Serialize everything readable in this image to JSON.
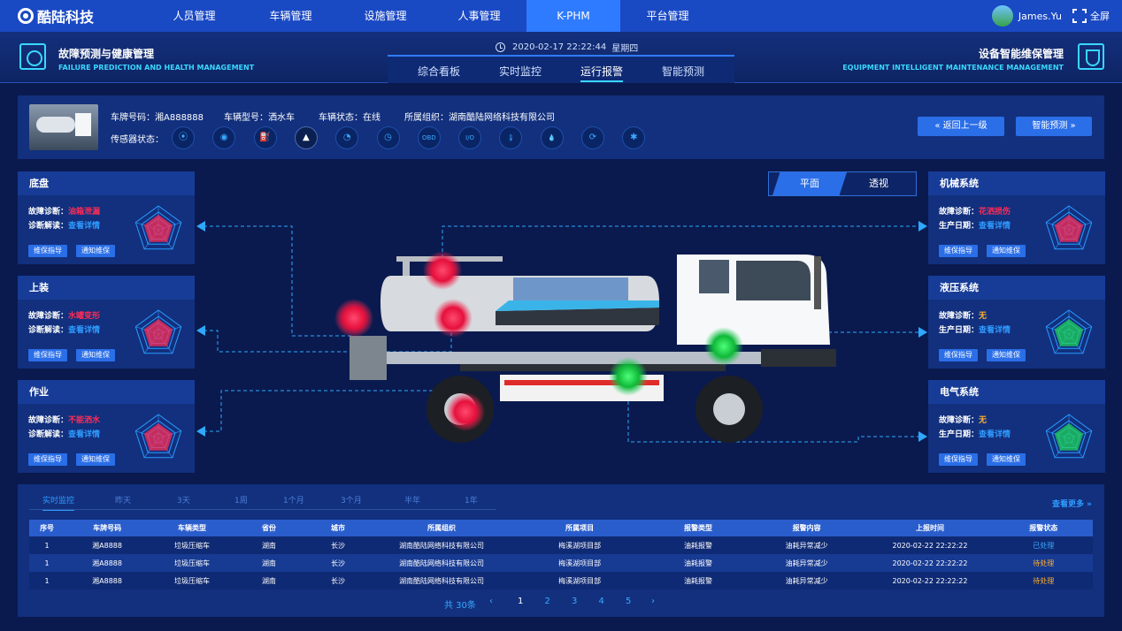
{
  "brand": {
    "name": "酷陆科技"
  },
  "nav": {
    "items": [
      {
        "label": "人员管理"
      },
      {
        "label": "车辆管理"
      },
      {
        "label": "设施管理"
      },
      {
        "label": "人事管理"
      },
      {
        "label": "K-PHM"
      },
      {
        "label": "平台管理"
      }
    ],
    "active_index": 4,
    "user_name": "James.Yu",
    "fullscreen_label": "全屏"
  },
  "subheader": {
    "left_title_cn": "故障预测与健康管理",
    "left_title_en": "FAILURE PREDICTION AND HEALTH MANAGEMENT",
    "right_title_cn": "设备智能维保管理",
    "right_title_en": "EQUIPMENT INTELLIGENT MAINTENANCE MANAGEMENT",
    "datetime": "2020-02-17 22:22:44",
    "weekday": "星期四",
    "tabs": [
      {
        "label": "综合看板"
      },
      {
        "label": "实时监控"
      },
      {
        "label": "运行报警"
      },
      {
        "label": "智能预测"
      }
    ],
    "active_tab": 2
  },
  "vehicle": {
    "plate_label": "车牌号码：",
    "plate": "湘A888888",
    "model_label": "车辆型号：",
    "model": "洒水车",
    "status_label": "车辆状态：",
    "status": "在线",
    "org_label": "所属组织：",
    "org": "湖南酷陆网络科技有限公司",
    "sensor_label": "传感器状态："
  },
  "sensors": [
    {
      "icon": "location-icon",
      "glyph": "⦿"
    },
    {
      "icon": "camera-icon",
      "glyph": "◉"
    },
    {
      "icon": "fuel-icon",
      "glyph": "⛽"
    },
    {
      "icon": "alarm-icon",
      "glyph": "▲"
    },
    {
      "icon": "gauge-icon",
      "glyph": "◔"
    },
    {
      "icon": "timer-icon",
      "glyph": "◷"
    },
    {
      "icon": "obd-icon",
      "glyph": "OBD"
    },
    {
      "icon": "io-icon",
      "glyph": "I/O"
    },
    {
      "icon": "thermometer-icon",
      "glyph": "🌡"
    },
    {
      "icon": "water-drop-icon",
      "glyph": "💧"
    },
    {
      "icon": "sync-icon",
      "glyph": "⟳"
    },
    {
      "icon": "fan-icon",
      "glyph": "✱"
    }
  ],
  "actions": {
    "back_label": "返回上一级",
    "predict_label": "智能预测"
  },
  "view_toggle": {
    "options": [
      "平面",
      "透视"
    ],
    "active": 0
  },
  "panels_left": [
    {
      "title": "底盘",
      "diag_label": "故障诊断：",
      "diag_value": "油箱泄漏",
      "diag_color": "#ff2b55",
      "interp_label": "诊断解读：",
      "interp_value": "查看详情",
      "btn1": "维保指导",
      "btn2": "通知维保",
      "status": "fault"
    },
    {
      "title": "上装",
      "diag_label": "故障诊断：",
      "diag_value": "水罐变形",
      "diag_color": "#ff2b55",
      "interp_label": "诊断解读：",
      "interp_value": "查看详情",
      "btn1": "维保指导",
      "btn2": "通知维保",
      "status": "fault"
    },
    {
      "title": "作业",
      "diag_label": "故障诊断：",
      "diag_value": "不能洒水",
      "diag_color": "#ff2b55",
      "interp_label": "诊断解读：",
      "interp_value": "查看详情",
      "btn1": "维保指导",
      "btn2": "通知维保",
      "status": "fault"
    }
  ],
  "panels_right": [
    {
      "title": "机械系统",
      "diag_label": "故障诊断：",
      "diag_value": "花洒损伤",
      "diag_color": "#ff2b55",
      "interp_label": "生产日期：",
      "interp_value": "查看详情",
      "btn1": "维保指导",
      "btn2": "通知维保",
      "status": "fault"
    },
    {
      "title": "液压系统",
      "diag_label": "故障诊断：",
      "diag_value": "无",
      "diag_color": "#ffb02e",
      "interp_label": "生产日期：",
      "interp_value": "查看详情",
      "btn1": "维保指导",
      "btn2": "通知维保",
      "status": "ok"
    },
    {
      "title": "电气系统",
      "diag_label": "故障诊断：",
      "diag_value": "无",
      "diag_color": "#ffb02e",
      "interp_label": "生产日期：",
      "interp_value": "查看详情",
      "btn1": "维保指导",
      "btn2": "通知维保",
      "status": "ok"
    }
  ],
  "colors": {
    "fault": "#ff2b55",
    "ok": "#1fd15a",
    "accent": "#2f7bff"
  },
  "bottom": {
    "tabs": [
      "实时监控",
      "昨天",
      "3天",
      "1周",
      "1个月",
      "3个月",
      "半年",
      "1年"
    ],
    "active_tab": 0,
    "more_label": "查看更多",
    "columns": [
      "序号",
      "车牌号码",
      "车辆类型",
      "省份",
      "城市",
      "所属组织",
      "所属项目",
      "报警类型",
      "报警内容",
      "上报时间",
      "报警状态"
    ],
    "rows": [
      [
        "1",
        "湘A8888",
        "垃圾压缩车",
        "湖南",
        "长沙",
        "湖南酷陆网络科技有限公司",
        "梅溪湖项目部",
        "油耗报警",
        "油耗异常减少",
        "2020-02-22 22:22:22",
        "已处理"
      ],
      [
        "1",
        "湘A8888",
        "垃圾压缩车",
        "湖南",
        "长沙",
        "湖南酷陆网络科技有限公司",
        "梅溪湖项目部",
        "油耗报警",
        "油耗异常减少",
        "2020-02-22 22:22:22",
        "待处理"
      ],
      [
        "1",
        "湘A8888",
        "垃圾压缩车",
        "湖南",
        "长沙",
        "湖南酷陆网络科技有限公司",
        "梅溪湖项目部",
        "油耗报警",
        "油耗异常减少",
        "2020-02-22 22:22:22",
        "待处理"
      ]
    ],
    "status_colors": {
      "已处理": "#3aa9ff",
      "待处理": "#ffb02e"
    },
    "pager": {
      "total": "共 30条",
      "prev": "‹",
      "next": "›",
      "pages": [
        "1",
        "2",
        "3",
        "4",
        "5"
      ],
      "current": 0
    }
  }
}
